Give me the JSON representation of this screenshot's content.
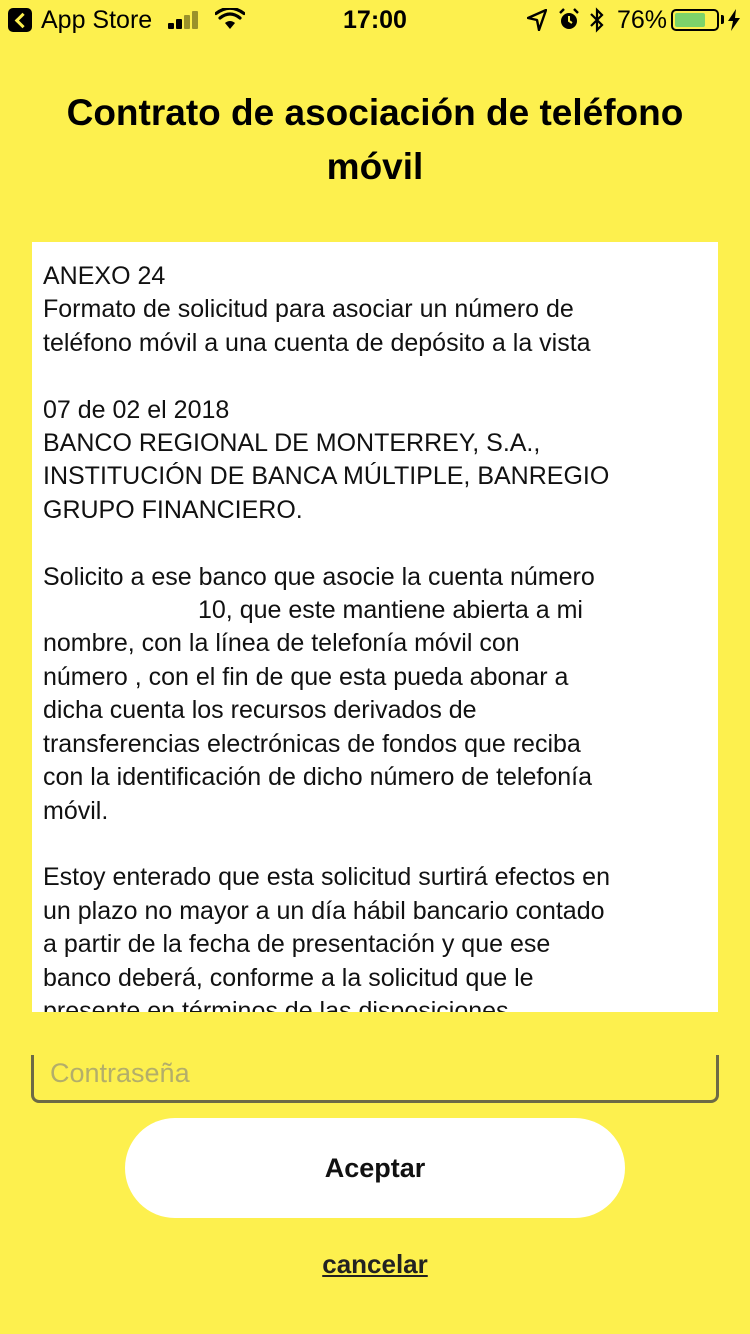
{
  "status_bar": {
    "back_app": "App Store",
    "time": "17:00",
    "battery_percent": "76%",
    "battery_level": 0.76
  },
  "header": {
    "title": "Contrato de asociación de teléfono móvil"
  },
  "contract": {
    "lines": [
      "ANEXO 24",
      "Formato de solicitud para asociar un número de",
      "teléfono móvil a una cuenta de depósito a la vista",
      "",
      " 07 de 02 el 2018",
      "BANCO REGIONAL DE MONTERREY, S.A.,",
      "INSTITUCIÓN DE BANCA MÚLTIPLE, BANREGIO",
      "GRUPO FINANCIERO.",
      "",
      "Solicito a ese banco que asocie la cuenta número",
      "010, que este mantiene abierta a mi",
      "nombre, con la línea de telefonía móvil con",
      "número  , con el fin de que esta pueda abonar a",
      "dicha cuenta los recursos derivados de",
      "transferencias electrónicas de fondos que reciba",
      "con la identificación de dicho número de telefonía",
      "móvil.",
      "",
      "Estoy enterado que esta solicitud surtirá efectos en",
      "un plazo no mayor a un día hábil bancario contado",
      "a partir de la fecha de presentación y que ese",
      "banco deberá, conforme a la solicitud que le",
      "presente en términos de las disposiciones"
    ]
  },
  "form": {
    "password_placeholder": "Contraseña",
    "password_value": ""
  },
  "actions": {
    "accept_label": "Aceptar",
    "cancel_label": "cancelar"
  },
  "colors": {
    "background": "#FDF04E",
    "button": "#FFFFFF",
    "battery_fill": "#7DD36A"
  }
}
